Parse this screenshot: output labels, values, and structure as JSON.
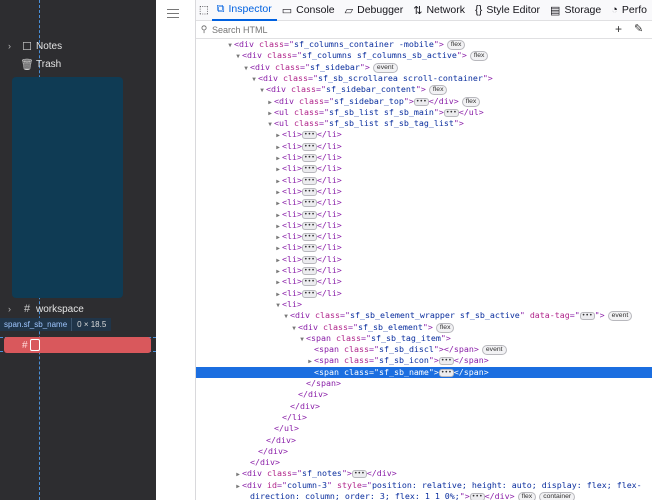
{
  "app": {
    "sidebar": {
      "items": [
        {
          "label": "Notes",
          "icon": "notes-icon"
        },
        {
          "label": "Trash",
          "icon": "trash-icon"
        }
      ],
      "workspace_label": "workspace"
    },
    "inspector_tooltip": {
      "selector": "span.sf_sb_name",
      "size": "0 × 18.5"
    },
    "highlight_glyph": "#"
  },
  "devtools": {
    "tabs": [
      {
        "label": "Inspector",
        "icon": "inspector-icon",
        "active": true
      },
      {
        "label": "Console",
        "icon": "console-icon",
        "active": false
      },
      {
        "label": "Debugger",
        "icon": "debugger-icon",
        "active": false
      },
      {
        "label": "Network",
        "icon": "network-icon",
        "active": false
      },
      {
        "label": "Style Editor",
        "icon": "style-editor-icon",
        "active": false
      },
      {
        "label": "Storage",
        "icon": "storage-icon",
        "active": false
      },
      {
        "label": "Perfo",
        "icon": "performance-icon",
        "active": false
      }
    ],
    "search_placeholder": "Search HTML",
    "selected_line_index": 29,
    "tree": [
      {
        "indent": 0,
        "tw": "open",
        "parts": [
          [
            "tg",
            "<div "
          ],
          [
            "an",
            "class"
          ],
          [
            "tg",
            "=\""
          ],
          [
            "av",
            "sf_columns_container -mobile"
          ],
          [
            "tg",
            "\">"
          ]
        ],
        "badges": [
          "flex"
        ]
      },
      {
        "indent": 1,
        "tw": "open",
        "parts": [
          [
            "tg",
            "<div "
          ],
          [
            "an",
            "class"
          ],
          [
            "tg",
            "=\""
          ],
          [
            "av",
            "sf_columns sf_columns_sb_active"
          ],
          [
            "tg",
            "\">"
          ]
        ],
        "badges": [
          "flex"
        ]
      },
      {
        "indent": 2,
        "tw": "open",
        "parts": [
          [
            "tg",
            "<div "
          ],
          [
            "an",
            "class"
          ],
          [
            "tg",
            "=\""
          ],
          [
            "av",
            "sf_sidebar"
          ],
          [
            "tg",
            "\">"
          ]
        ],
        "badges": [
          "event"
        ]
      },
      {
        "indent": 3,
        "tw": "open",
        "parts": [
          [
            "tg",
            "<div "
          ],
          [
            "an",
            "class"
          ],
          [
            "tg",
            "=\""
          ],
          [
            "av",
            "sf_sb_scrollarea scroll-container"
          ],
          [
            "tg",
            "\">"
          ]
        ],
        "badges": []
      },
      {
        "indent": 4,
        "tw": "open",
        "parts": [
          [
            "tg",
            "<div "
          ],
          [
            "an",
            "class"
          ],
          [
            "tg",
            "=\""
          ],
          [
            "av",
            "sf_sidebar_content"
          ],
          [
            "tg",
            "\">"
          ]
        ],
        "badges": [
          "flex"
        ]
      },
      {
        "indent": 5,
        "tw": "closed",
        "parts": [
          [
            "tg",
            "<div "
          ],
          [
            "an",
            "class"
          ],
          [
            "tg",
            "=\""
          ],
          [
            "av",
            "sf_sidebar_top"
          ],
          [
            "tg",
            "\">"
          ],
          [
            "dots",
            ""
          ],
          [
            "tg",
            "</div>"
          ]
        ],
        "badges": [
          "flex"
        ]
      },
      {
        "indent": 5,
        "tw": "closed",
        "parts": [
          [
            "tg",
            "<ul "
          ],
          [
            "an",
            "class"
          ],
          [
            "tg",
            "=\""
          ],
          [
            "av",
            "sf_sb_list sf_sb_main"
          ],
          [
            "tg",
            "\">"
          ],
          [
            "dots",
            ""
          ],
          [
            "tg",
            "</ul>"
          ]
        ],
        "badges": []
      },
      {
        "indent": 5,
        "tw": "open",
        "parts": [
          [
            "tg",
            "<ul "
          ],
          [
            "an",
            "class"
          ],
          [
            "tg",
            "=\""
          ],
          [
            "av",
            "sf_sb_list sf_sb_tag_list"
          ],
          [
            "tg",
            "\">"
          ]
        ],
        "badges": []
      },
      {
        "indent": 6,
        "tw": "closed",
        "parts": [
          [
            "tg",
            "<li>"
          ],
          [
            "dots",
            ""
          ],
          [
            "tg",
            "</li>"
          ]
        ],
        "badges": []
      },
      {
        "indent": 6,
        "tw": "closed",
        "parts": [
          [
            "tg",
            "<li>"
          ],
          [
            "dots",
            ""
          ],
          [
            "tg",
            "</li>"
          ]
        ],
        "badges": []
      },
      {
        "indent": 6,
        "tw": "closed",
        "parts": [
          [
            "tg",
            "<li>"
          ],
          [
            "dots",
            ""
          ],
          [
            "tg",
            "</li>"
          ]
        ],
        "badges": []
      },
      {
        "indent": 6,
        "tw": "closed",
        "parts": [
          [
            "tg",
            "<li>"
          ],
          [
            "dots",
            ""
          ],
          [
            "tg",
            "</li>"
          ]
        ],
        "badges": []
      },
      {
        "indent": 6,
        "tw": "closed",
        "parts": [
          [
            "tg",
            "<li>"
          ],
          [
            "dots",
            ""
          ],
          [
            "tg",
            "</li>"
          ]
        ],
        "badges": []
      },
      {
        "indent": 6,
        "tw": "closed",
        "parts": [
          [
            "tg",
            "<li>"
          ],
          [
            "dots",
            ""
          ],
          [
            "tg",
            "</li>"
          ]
        ],
        "badges": []
      },
      {
        "indent": 6,
        "tw": "closed",
        "parts": [
          [
            "tg",
            "<li>"
          ],
          [
            "dots",
            ""
          ],
          [
            "tg",
            "</li>"
          ]
        ],
        "badges": []
      },
      {
        "indent": 6,
        "tw": "closed",
        "parts": [
          [
            "tg",
            "<li>"
          ],
          [
            "dots",
            ""
          ],
          [
            "tg",
            "</li>"
          ]
        ],
        "badges": []
      },
      {
        "indent": 6,
        "tw": "closed",
        "parts": [
          [
            "tg",
            "<li>"
          ],
          [
            "dots",
            ""
          ],
          [
            "tg",
            "</li>"
          ]
        ],
        "badges": []
      },
      {
        "indent": 6,
        "tw": "closed",
        "parts": [
          [
            "tg",
            "<li>"
          ],
          [
            "dots",
            ""
          ],
          [
            "tg",
            "</li>"
          ]
        ],
        "badges": []
      },
      {
        "indent": 6,
        "tw": "closed",
        "parts": [
          [
            "tg",
            "<li>"
          ],
          [
            "dots",
            ""
          ],
          [
            "tg",
            "</li>"
          ]
        ],
        "badges": []
      },
      {
        "indent": 6,
        "tw": "closed",
        "parts": [
          [
            "tg",
            "<li>"
          ],
          [
            "dots",
            ""
          ],
          [
            "tg",
            "</li>"
          ]
        ],
        "badges": []
      },
      {
        "indent": 6,
        "tw": "closed",
        "parts": [
          [
            "tg",
            "<li>"
          ],
          [
            "dots",
            ""
          ],
          [
            "tg",
            "</li>"
          ]
        ],
        "badges": []
      },
      {
        "indent": 6,
        "tw": "closed",
        "parts": [
          [
            "tg",
            "<li>"
          ],
          [
            "dots",
            ""
          ],
          [
            "tg",
            "</li>"
          ]
        ],
        "badges": []
      },
      {
        "indent": 6,
        "tw": "closed",
        "parts": [
          [
            "tg",
            "<li>"
          ],
          [
            "dots",
            ""
          ],
          [
            "tg",
            "</li>"
          ]
        ],
        "badges": []
      },
      {
        "indent": 6,
        "tw": "open",
        "parts": [
          [
            "tg",
            "<li>"
          ]
        ],
        "badges": []
      },
      {
        "indent": 7,
        "tw": "open",
        "parts": [
          [
            "tg",
            "<div "
          ],
          [
            "an",
            "class"
          ],
          [
            "tg",
            "=\""
          ],
          [
            "av",
            "sf_sb_element_wrapper sf_sb_active"
          ],
          [
            "tg",
            "\" "
          ],
          [
            "an",
            "data-tag"
          ],
          [
            "tg",
            "=\""
          ],
          [
            "dots",
            ""
          ],
          [
            "tg",
            "\">"
          ]
        ],
        "badges": [
          "event"
        ]
      },
      {
        "indent": 8,
        "tw": "open",
        "parts": [
          [
            "tg",
            "<div "
          ],
          [
            "an",
            "class"
          ],
          [
            "tg",
            "=\""
          ],
          [
            "av",
            "sf_sb_element"
          ],
          [
            "tg",
            "\">"
          ]
        ],
        "badges": [
          "flex"
        ]
      },
      {
        "indent": 9,
        "tw": "open",
        "parts": [
          [
            "tg",
            "<span "
          ],
          [
            "an",
            "class"
          ],
          [
            "tg",
            "=\""
          ],
          [
            "av",
            "sf_sb_tag_item"
          ],
          [
            "tg",
            "\">"
          ]
        ],
        "badges": []
      },
      {
        "indent": 10,
        "tw": "none",
        "parts": [
          [
            "tg",
            "<span "
          ],
          [
            "an",
            "class"
          ],
          [
            "tg",
            "=\""
          ],
          [
            "av",
            "sf_sb_discl"
          ],
          [
            "tg",
            "\"></span>"
          ]
        ],
        "badges": [
          "event"
        ]
      },
      {
        "indent": 10,
        "tw": "closed",
        "parts": [
          [
            "tg",
            "<span "
          ],
          [
            "an",
            "class"
          ],
          [
            "tg",
            "=\""
          ],
          [
            "av",
            "sf_sb_icon"
          ],
          [
            "tg",
            "\">"
          ],
          [
            "dots",
            ""
          ],
          [
            "tg",
            "</span>"
          ]
        ],
        "badges": []
      },
      {
        "indent": 10,
        "tw": "none",
        "parts": [
          [
            "tg",
            "<span "
          ],
          [
            "an",
            "class"
          ],
          [
            "tg",
            "=\""
          ],
          [
            "av",
            "sf_sb_name"
          ],
          [
            "tg",
            "\">"
          ],
          [
            "dots",
            ""
          ],
          [
            "tg",
            "</span>"
          ]
        ],
        "badges": []
      },
      {
        "indent": 9,
        "tw": "none",
        "parts": [
          [
            "tg",
            "</span>"
          ]
        ],
        "badges": []
      },
      {
        "indent": 8,
        "tw": "none",
        "parts": [
          [
            "tg",
            "</div>"
          ]
        ],
        "badges": []
      },
      {
        "indent": 7,
        "tw": "none",
        "parts": [
          [
            "tg",
            "</div>"
          ]
        ],
        "badges": []
      },
      {
        "indent": 6,
        "tw": "none",
        "parts": [
          [
            "tg",
            "</li>"
          ]
        ],
        "badges": []
      },
      {
        "indent": 5,
        "tw": "none",
        "parts": [
          [
            "tg",
            "</ul>"
          ]
        ],
        "badges": []
      },
      {
        "indent": 4,
        "tw": "none",
        "parts": [
          [
            "tg",
            "</div>"
          ]
        ],
        "badges": []
      },
      {
        "indent": 3,
        "tw": "none",
        "parts": [
          [
            "tg",
            "</div>"
          ]
        ],
        "badges": []
      },
      {
        "indent": 2,
        "tw": "none",
        "parts": [
          [
            "tg",
            "</div>"
          ]
        ],
        "badges": []
      },
      {
        "indent": 1,
        "tw": "closed",
        "parts": [
          [
            "tg",
            "<div "
          ],
          [
            "an",
            "class"
          ],
          [
            "tg",
            "=\""
          ],
          [
            "av",
            "sf_notes"
          ],
          [
            "tg",
            "\">"
          ],
          [
            "dots",
            ""
          ],
          [
            "tg",
            "</div>"
          ]
        ],
        "badges": []
      },
      {
        "indent": 1,
        "tw": "closed",
        "parts": [
          [
            "tg",
            "<div "
          ],
          [
            "an",
            "id"
          ],
          [
            "tg",
            "=\""
          ],
          [
            "av",
            "column-3"
          ],
          [
            "tg",
            "\" "
          ],
          [
            "an",
            "style"
          ],
          [
            "tg",
            "=\""
          ],
          [
            "av",
            "position: relative; height: auto; display: flex; flex-"
          ]
        ],
        "badges": []
      },
      {
        "indent": 2,
        "tw": "none",
        "parts": [
          [
            "av",
            "direction: column; order: 3; flex: 1 1 0%;"
          ],
          [
            "tg",
            "\">"
          ],
          [
            "dots",
            ""
          ],
          [
            "tg",
            "</div>"
          ]
        ],
        "badges": [
          "flex",
          "container"
        ]
      }
    ]
  }
}
